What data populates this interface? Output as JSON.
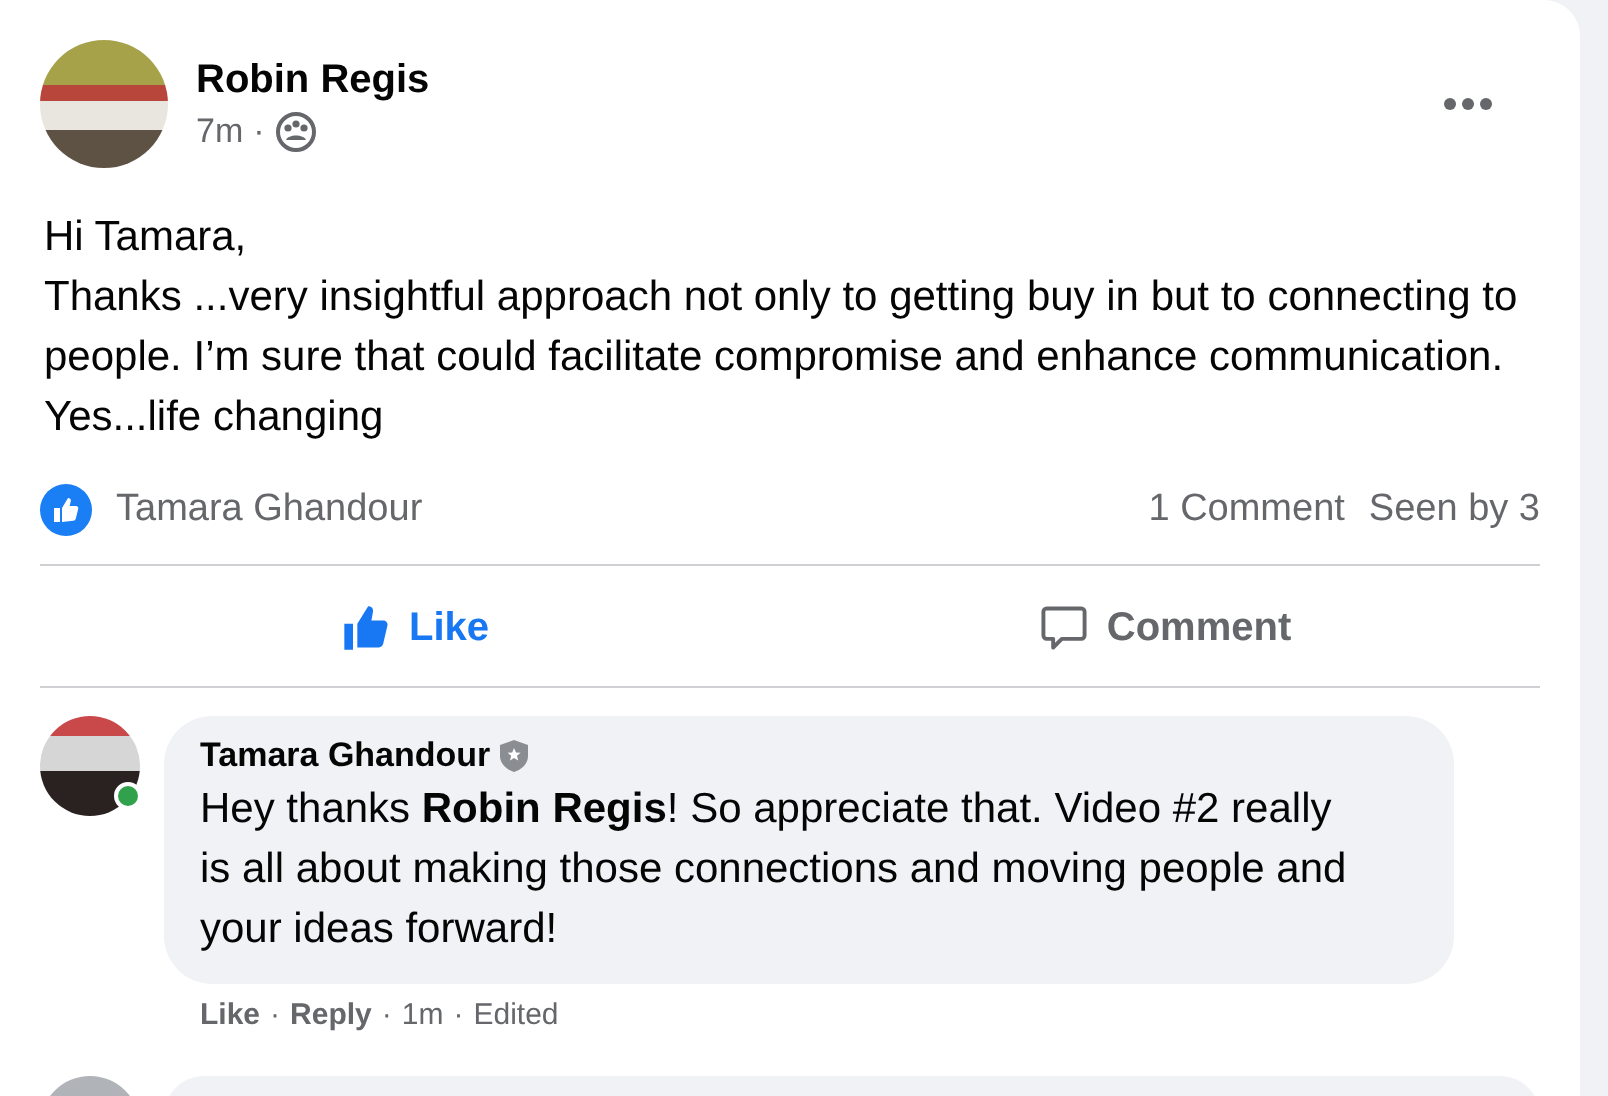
{
  "post": {
    "author": "Robin Regis",
    "time": "7m",
    "separator": "·",
    "body": "Hi Tamara,\nThanks ...very insightful approach not only to getting buy in but to connecting to people. I’m sure that could facilitate compromise and enhance communication. Yes...life changing",
    "reactions": {
      "names": "Tamara Ghandour"
    },
    "comment_count": "1 Comment",
    "seen_by": "Seen by 3",
    "actions": [
      {
        "kind": "like",
        "label": "Like",
        "selected": true
      },
      {
        "kind": "comment",
        "label": "Comment",
        "selected": false
      }
    ],
    "comments": [
      {
        "author": "Tamara Ghandour",
        "online": true,
        "text": "Hey thanks **Robin Regis**! So appreciate that. Video #2 really is all about making those connections and moving people and your ideas forward!",
        "actions": [
          "Like",
          "Reply"
        ],
        "separators": [
          "·",
          "·",
          "·"
        ],
        "time": "1m",
        "edited": "Edited"
      }
    ]
  }
}
